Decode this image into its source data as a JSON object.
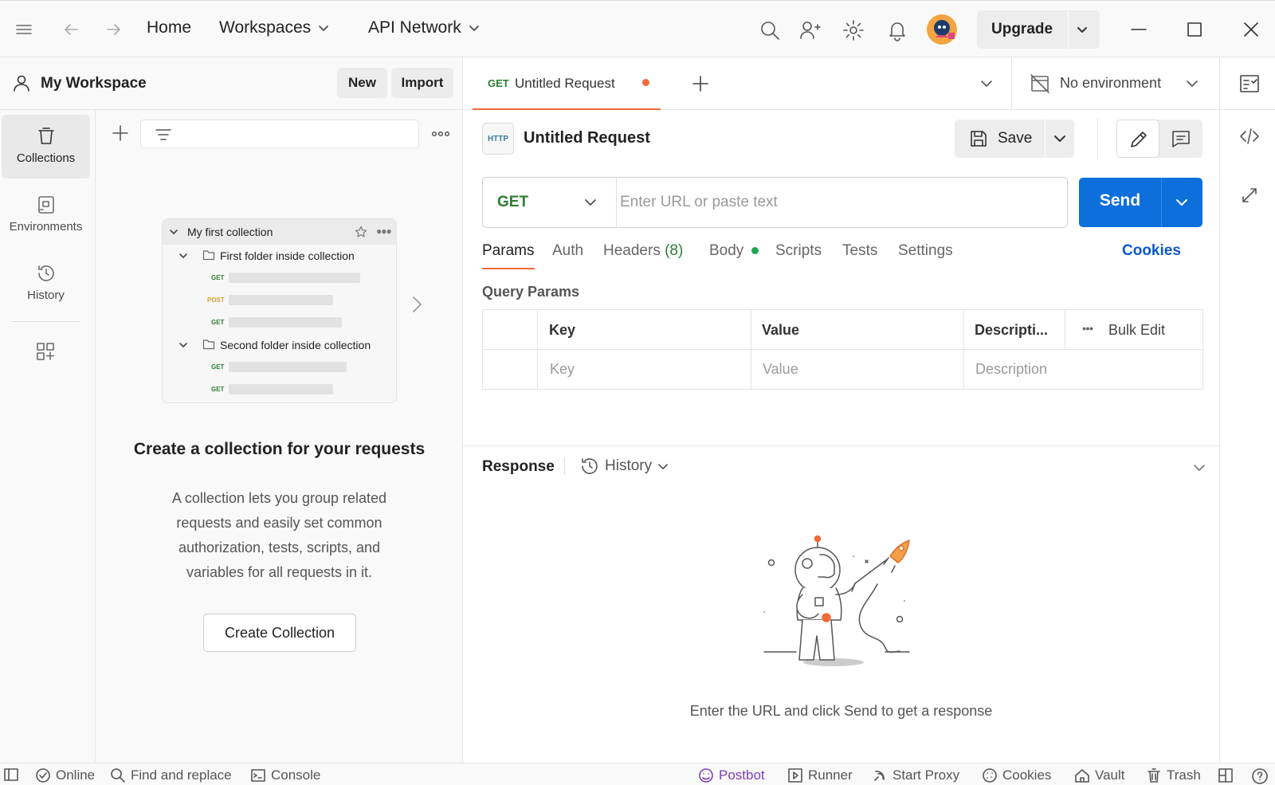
{
  "titlebar": {
    "home": "Home",
    "workspaces": "Workspaces",
    "api_network": "API Network",
    "upgrade": "Upgrade"
  },
  "workspace": {
    "name": "My Workspace",
    "new_label": "New",
    "import_label": "Import"
  },
  "rail": {
    "items": [
      {
        "label": "Collections"
      },
      {
        "label": "Environments"
      },
      {
        "label": "History"
      }
    ]
  },
  "collections": {
    "preview": {
      "collection": "My first collection",
      "folder1": "First folder inside collection",
      "folder2": "Second folder inside collection",
      "methods": [
        "GET",
        "POST",
        "GET",
        "GET",
        "GET"
      ]
    },
    "empty_title": "Create a collection for your requests",
    "empty_desc": "A collection lets you group related requests and easily set common authorization, tests, scripts, and variables for all requests in it.",
    "create_button": "Create Collection"
  },
  "tabbar": {
    "tab_method": "GET",
    "tab_name": "Untitled Request",
    "environment": "No environment"
  },
  "request": {
    "badge": "HTTP",
    "title": "Untitled Request",
    "save_label": "Save",
    "method": "GET",
    "url_placeholder": "Enter URL or paste text",
    "send_label": "Send",
    "tabs": {
      "params": "Params",
      "auth": "Auth",
      "headers": "Headers",
      "headers_count": "(8)",
      "body": "Body",
      "scripts": "Scripts",
      "tests": "Tests",
      "settings": "Settings",
      "cookies": "Cookies"
    },
    "query_params": {
      "title": "Query Params",
      "col_key": "Key",
      "col_value": "Value",
      "col_desc": "Descripti...",
      "bulk_edit": "Bulk Edit",
      "ph_key": "Key",
      "ph_value": "Value",
      "ph_desc": "Description"
    }
  },
  "response": {
    "title": "Response",
    "history": "History",
    "empty_message": "Enter the URL and click Send to get a response"
  },
  "statusbar": {
    "online": "Online",
    "find_replace": "Find and replace",
    "console": "Console",
    "postbot": "Postbot",
    "runner": "Runner",
    "start_proxy": "Start Proxy",
    "cookies": "Cookies",
    "vault": "Vault",
    "trash": "Trash"
  },
  "colors": {
    "accent_orange": "#f26b3a",
    "send_blue": "#0d6fdb",
    "get_green": "#2e7d32",
    "post_orange": "#d9a036",
    "cookies_link": "#0b57c9",
    "postbot_purple": "#7b3fb8"
  }
}
